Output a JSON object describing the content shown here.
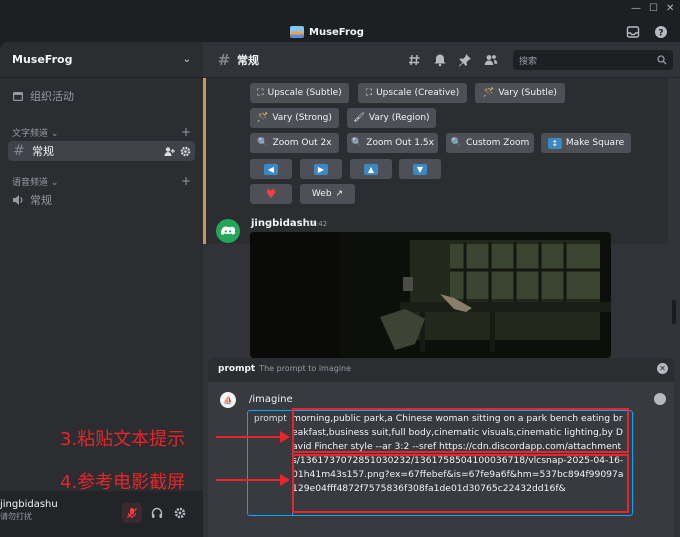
{
  "window": {
    "title": "MuseFrog",
    "controls": [
      "—",
      "☐",
      "✕"
    ]
  },
  "titlebar_icons": [
    "inbox-icon",
    "help-icon"
  ],
  "server": {
    "name": "MuseFrog"
  },
  "sidebar": {
    "events_label": "组织活动",
    "text_category": "文字频道",
    "text_channel": "常规",
    "voice_category": "语音频道",
    "voice_channel": "常规"
  },
  "user": {
    "name": "jingbidashu",
    "status": "请勿打扰"
  },
  "channel": {
    "name": "常规",
    "search_placeholder": "搜索"
  },
  "buttons": {
    "upscale_subtle": "Upscale (Subtle)",
    "upscale_creative": "Upscale (Creative)",
    "vary_subtle": "Vary (Subtle)",
    "vary_strong": "Vary (Strong)",
    "vary_region": "Vary (Region)",
    "zoom_out_2x": "Zoom Out 2x",
    "zoom_out_15x": "Zoom Out 1.5x",
    "custom_zoom": "Custom Zoom",
    "make_square": "Make Square",
    "web": "Web"
  },
  "message": {
    "author": "jingbidashu",
    "time": "01:42"
  },
  "prompt_panel": {
    "name": "prompt",
    "description": "The prompt to imagine",
    "command": "/imagine",
    "param_label": "prompt",
    "text": "morning,public park,a Chinese woman sitting on a park bench eating breakfast,business suit,full body,cinematic visuals,cinematic lighting,by David Fincher style --ar 3:2 --sref https://cdn.discordapp.com/attachments/1361737072851030232/1361758504100036718/vlcsnap-2025-04-16-01h41m43s157.png?ex=67ffebef&is=67fe9a6f&hm=537bc894f99097a129e04fff4872f7575836f308fa1de01d30765c22432dd16f&"
  },
  "annotations": {
    "step3": "3.粘贴文本提示",
    "step4": "4.参考电影截屏"
  },
  "colors": {
    "accent_border": "#c59a5a",
    "annotation_red": "#e5262a",
    "focus_blue": "#00a8fc"
  }
}
